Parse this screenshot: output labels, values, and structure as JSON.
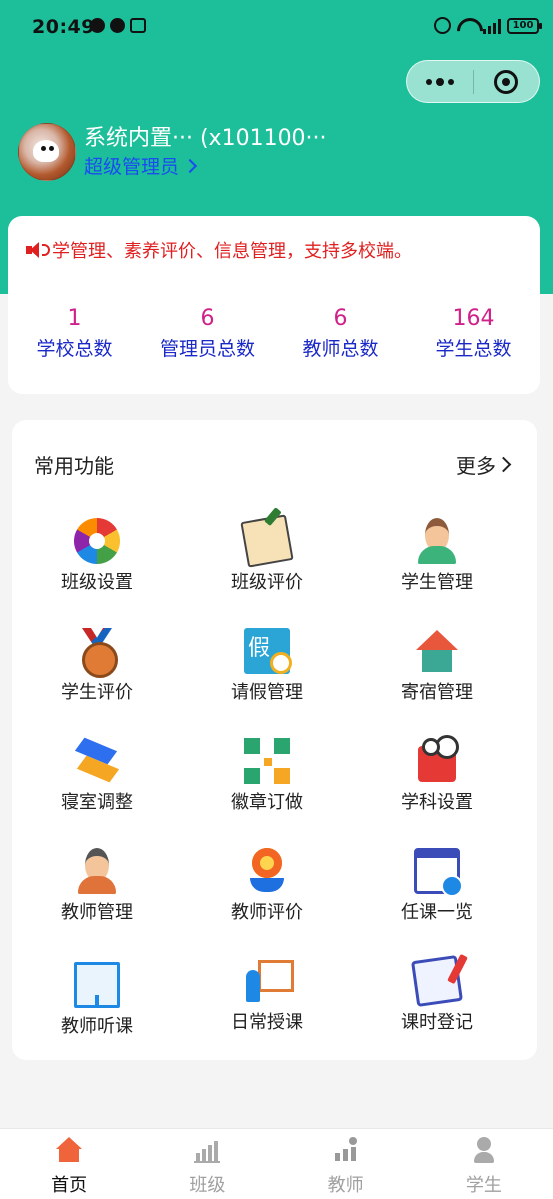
{
  "status_bar": {
    "time": "20:49",
    "battery": "100"
  },
  "profile": {
    "name": "系统内置··· (x101100···",
    "role": "超级管理员"
  },
  "notice": {
    "text": "学管理、素养评价、信息管理，支持多校端。"
  },
  "stats": [
    {
      "value": "1",
      "label": "学校总数"
    },
    {
      "value": "6",
      "label": "管理员总数"
    },
    {
      "value": "6",
      "label": "教师总数"
    },
    {
      "value": "164",
      "label": "学生总数"
    }
  ],
  "functions": {
    "title": "常用功能",
    "more_label": "更多",
    "items": [
      {
        "label": "班级设置",
        "icon": "aperture-icon"
      },
      {
        "label": "班级评价",
        "icon": "document-edit-icon"
      },
      {
        "label": "学生管理",
        "icon": "student-icon"
      },
      {
        "label": "学生评价",
        "icon": "medal-icon"
      },
      {
        "label": "请假管理",
        "icon": "leave-icon"
      },
      {
        "label": "寄宿管理",
        "icon": "house-icon"
      },
      {
        "label": "寝室调整",
        "icon": "dorm-icon"
      },
      {
        "label": "徽章订做",
        "icon": "qr-code-icon"
      },
      {
        "label": "学科设置",
        "icon": "book-icon"
      },
      {
        "label": "教师管理",
        "icon": "teacher-icon"
      },
      {
        "label": "教师评价",
        "icon": "flower-icon"
      },
      {
        "label": "任课一览",
        "icon": "calendar-icon"
      },
      {
        "label": "教师听课",
        "icon": "whiteboard-icon"
      },
      {
        "label": "日常授课",
        "icon": "lecture-icon"
      },
      {
        "label": "课时登记",
        "icon": "clipboard-icon"
      }
    ]
  },
  "tabbar": {
    "items": [
      {
        "label": "首页",
        "icon": "home-icon",
        "active": true
      },
      {
        "label": "班级",
        "icon": "chart-icon",
        "active": false
      },
      {
        "label": "教师",
        "icon": "teaching-icon",
        "active": false
      },
      {
        "label": "学生",
        "icon": "student-icon",
        "active": false
      }
    ]
  },
  "colors": {
    "header": "#1dbf9a",
    "stat_value": "#d0218a",
    "stat_label": "#1a28c8",
    "notice": "#e02020",
    "role": "#1a4cf0",
    "tab_active_icon": "#f0643c"
  }
}
